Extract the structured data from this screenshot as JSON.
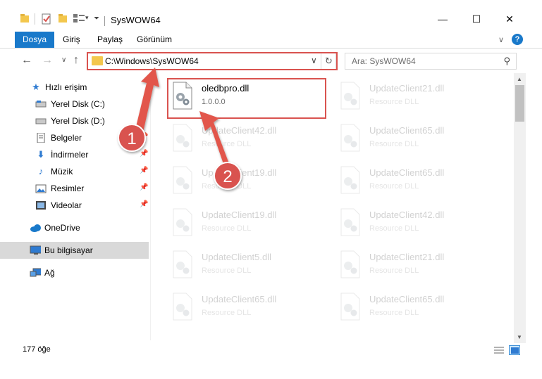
{
  "window": {
    "title": "SysWOW64",
    "minimize": "—",
    "maximize": "☐",
    "close": "✕"
  },
  "ribbon": {
    "tabs": [
      "Dosya",
      "Giriş",
      "Paylaş",
      "Görünüm"
    ],
    "active_tab": "Dosya",
    "help": "?"
  },
  "navigation": {
    "address": "C:\\Windows\\SysWOW64",
    "search_placeholder": "Ara: SysWOW64"
  },
  "sidebar": {
    "items": [
      {
        "label": "Hızlı erişim",
        "icon": "star-icon",
        "pinned": false
      },
      {
        "label": "Yerel Disk (C:)",
        "icon": "drive-icon",
        "pinned": false
      },
      {
        "label": "Yerel Disk (D:)",
        "icon": "drive-icon",
        "pinned": false
      },
      {
        "label": "Belgeler",
        "icon": "document-icon",
        "pinned": true
      },
      {
        "label": "İndirmeler",
        "icon": "download-icon",
        "pinned": true
      },
      {
        "label": "Müzik",
        "icon": "music-icon",
        "pinned": true
      },
      {
        "label": "Resimler",
        "icon": "picture-icon",
        "pinned": true
      },
      {
        "label": "Videolar",
        "icon": "video-icon",
        "pinned": true
      },
      {
        "label": "OneDrive",
        "icon": "cloud-icon",
        "pinned": false
      },
      {
        "label": "Bu bilgisayar",
        "icon": "computer-icon",
        "pinned": false,
        "selected": true
      },
      {
        "label": "Ağ",
        "icon": "network-icon",
        "pinned": false
      }
    ]
  },
  "files": [
    {
      "name": "oledbpro.dll",
      "desc": "1.0.0.0",
      "faded": false
    },
    {
      "name": "UpdateClient21.dll",
      "desc": "Resource DLL",
      "faded": true
    },
    {
      "name": "UpdateClient42.dll",
      "desc": "Resource DLL",
      "faded": true
    },
    {
      "name": "UpdateClient65.dll",
      "desc": "Resource DLL",
      "faded": true
    },
    {
      "name": "UpdateClient19.dll",
      "desc": "Resource DLL",
      "faded": true
    },
    {
      "name": "UpdateClient65.dll",
      "desc": "Resource DLL",
      "faded": true
    },
    {
      "name": "UpdateClient19.dll",
      "desc": "Resource DLL",
      "faded": true
    },
    {
      "name": "UpdateClient42.dll",
      "desc": "Resource DLL",
      "faded": true
    },
    {
      "name": "UpdateClient5.dll",
      "desc": "Resource DLL",
      "faded": true
    },
    {
      "name": "UpdateClient21.dll",
      "desc": "Resource DLL",
      "faded": true
    },
    {
      "name": "UpdateClient65.dll",
      "desc": "Resource DLL",
      "faded": true
    },
    {
      "name": "UpdateClient65.dll",
      "desc": "Resource DLL",
      "faded": true
    }
  ],
  "annotations": {
    "step1": "1",
    "step2": "2",
    "color": "#d9534f"
  },
  "status": {
    "item_count": "177 öğe"
  }
}
